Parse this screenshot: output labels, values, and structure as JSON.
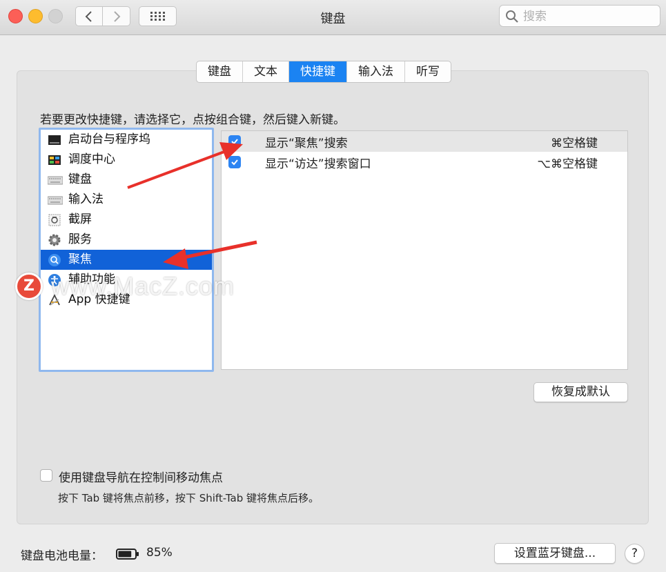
{
  "window": {
    "title": "键盘",
    "search_placeholder": "搜索"
  },
  "tabs": [
    {
      "label": "键盘",
      "active": false
    },
    {
      "label": "文本",
      "active": false
    },
    {
      "label": "快捷键",
      "active": true
    },
    {
      "label": "输入法",
      "active": false
    },
    {
      "label": "听写",
      "active": false
    }
  ],
  "instruction": "若要更改快捷键，请选择它，点按组合键，然后键入新键。",
  "categories": [
    {
      "label": "启动台与程序坞",
      "icon": "dock-icon"
    },
    {
      "label": "调度中心",
      "icon": "mission-control-icon"
    },
    {
      "label": "键盘",
      "icon": "keyboard-icon"
    },
    {
      "label": "输入法",
      "icon": "keyboard-icon"
    },
    {
      "label": "截屏",
      "icon": "screenshot-icon"
    },
    {
      "label": "服务",
      "icon": "gear-icon"
    },
    {
      "label": "聚焦",
      "icon": "spotlight-icon",
      "selected": true
    },
    {
      "label": "辅助功能",
      "icon": "accessibility-icon"
    },
    {
      "label": "App 快捷键",
      "icon": "app-store-icon"
    }
  ],
  "shortcuts": [
    {
      "label": "显示“聚焦”搜索",
      "key": "⌘空格键",
      "checked": true
    },
    {
      "label": "显示“访达”搜索窗口",
      "key": "⌥⌘空格键",
      "checked": true
    }
  ],
  "buttons": {
    "restore_defaults": "恢复成默认",
    "bluetooth_setup": "设置蓝牙键盘...",
    "help": "?"
  },
  "keyboard_nav": {
    "label": "使用键盘导航在控制间移动焦点",
    "checked": false,
    "hint": "按下 Tab 键将焦点前移，按下 Shift-Tab 键将焦点后移。"
  },
  "battery": {
    "label": "键盘电池电量：",
    "percent": "85%",
    "level": 0.85
  },
  "watermark": {
    "logo": "Z",
    "text": "www.MacZ.com"
  },
  "colors": {
    "accent": "#1b83f2",
    "selection": "#1162d8",
    "annotation_arrow": "#e8302a"
  }
}
